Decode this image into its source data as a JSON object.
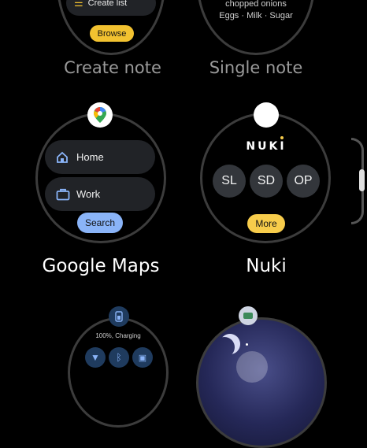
{
  "tiles": {
    "create_note": {
      "label": "Create note",
      "create_list": "Create list",
      "browse": "Browse"
    },
    "single_note": {
      "label": "Single note",
      "line1": "chopped onions",
      "line2": "Eggs · Milk · Sugar"
    },
    "google_maps": {
      "label": "Google Maps",
      "home": "Home",
      "work": "Work",
      "search": "Search"
    },
    "nuki": {
      "label": "Nuki",
      "brand": "NUKI",
      "buttons": [
        "SL",
        "SD",
        "OP"
      ],
      "more": "More"
    },
    "battery": {
      "status": "100%, Charging"
    }
  },
  "colors": {
    "browse_yellow": "#f2c230",
    "search_blue": "#8ab4f8",
    "more_yellow": "#f7cc4b",
    "ring": "#3c3c3c"
  }
}
